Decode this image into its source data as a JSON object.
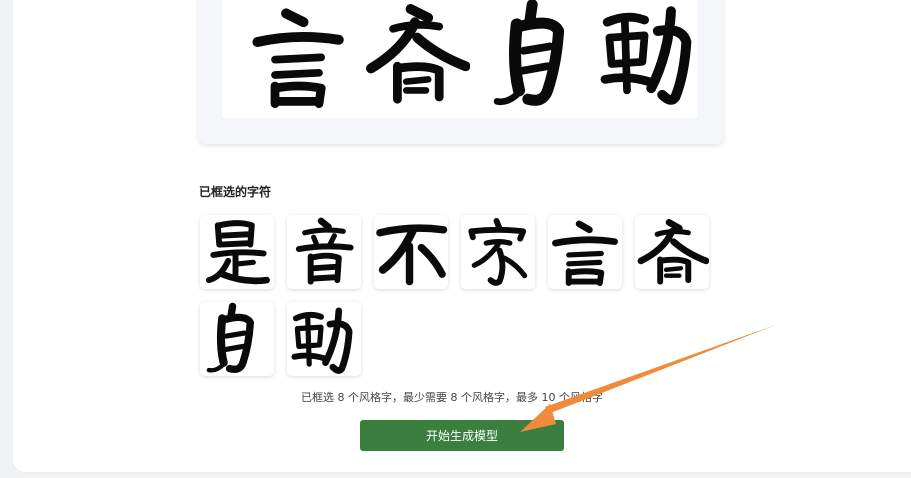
{
  "preview": {
    "characters": [
      "言",
      "喬",
      "自",
      "動"
    ]
  },
  "selected": {
    "title": "已框选的字符",
    "characters": [
      "是",
      "音",
      "不",
      "家",
      "言",
      "喬",
      "自",
      "動"
    ],
    "status_text": "已框选 8 个风格字，最少需要 8 个风格字，最多 10 个风格字"
  },
  "actions": {
    "generate_label": "开始生成模型"
  },
  "colors": {
    "button": "#3a7f3f",
    "annotation_arrow": "#f08a3c"
  },
  "icons": {
    "annotation": "arrow-annotation-icon"
  }
}
